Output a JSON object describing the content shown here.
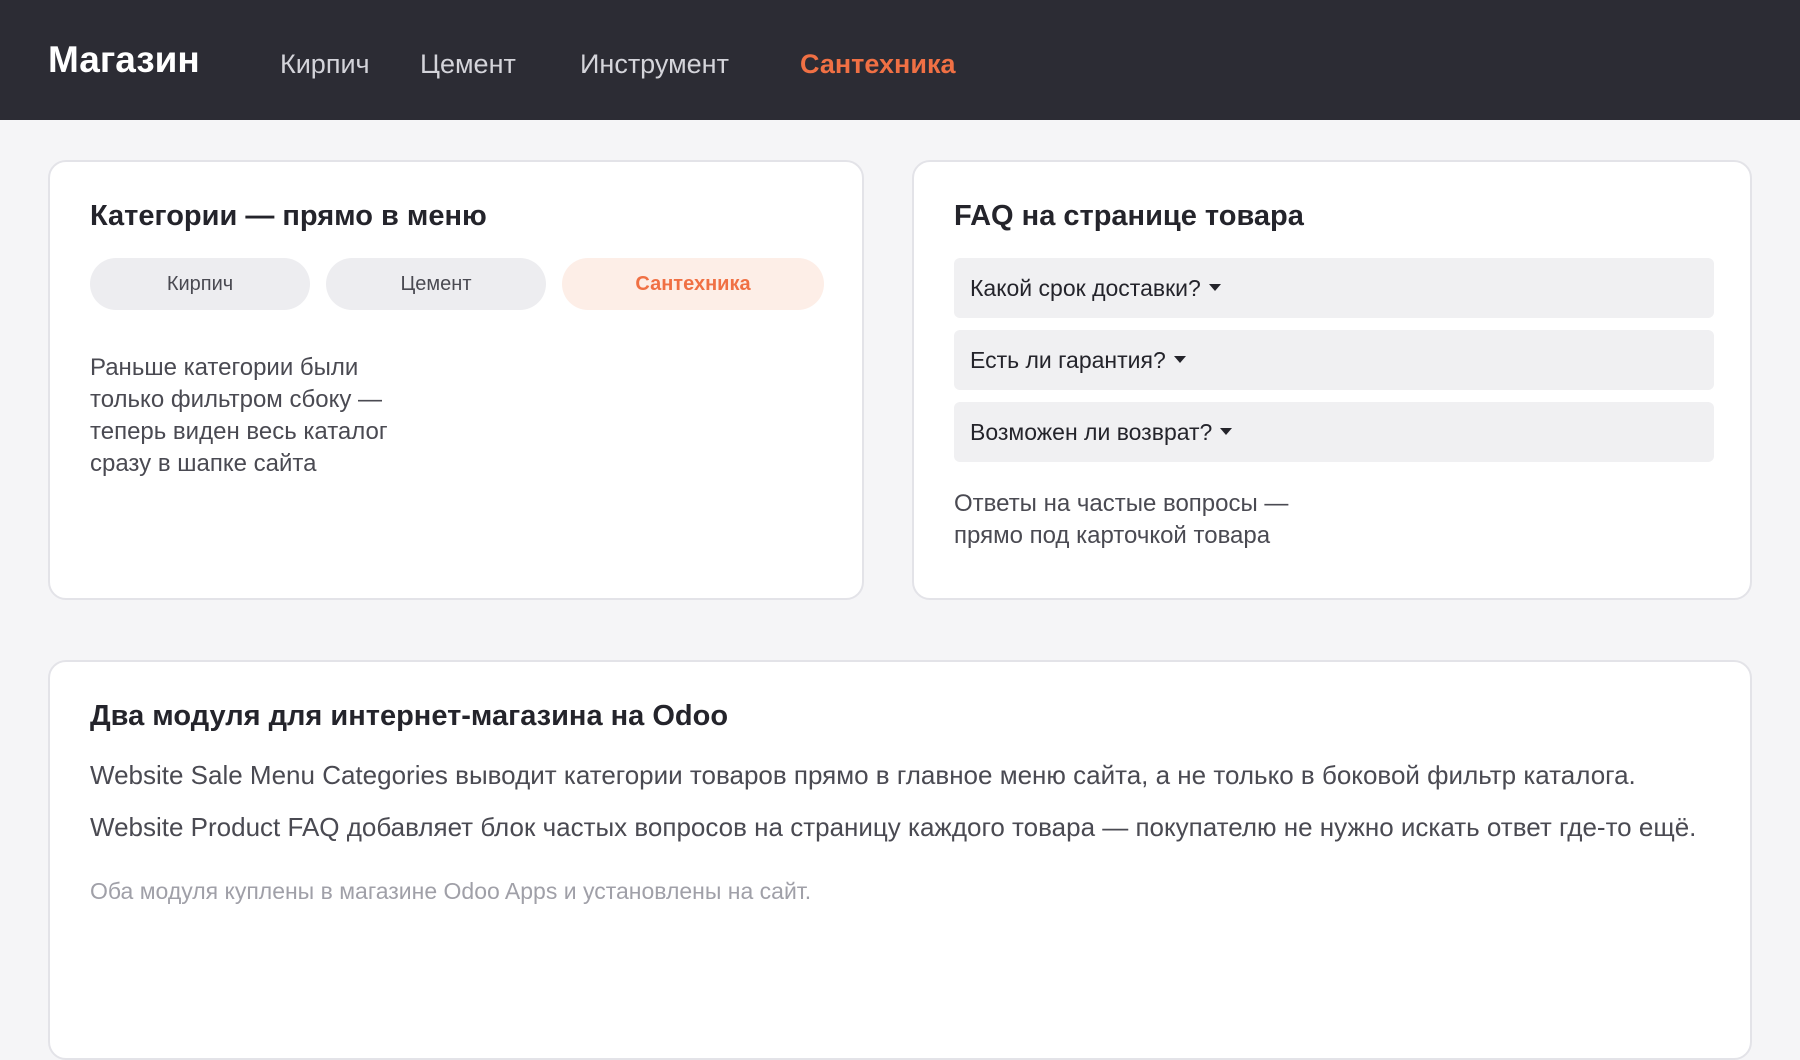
{
  "header": {
    "brand": "Магазин",
    "nav": [
      {
        "label": "Кирпич",
        "active": false
      },
      {
        "label": "Цемент",
        "active": false
      },
      {
        "label": "Инструмент",
        "active": false
      },
      {
        "label": "Сантехника",
        "active": true
      }
    ]
  },
  "categories_card": {
    "title": "Категории — прямо в меню",
    "chips": [
      {
        "label": "Кирпич",
        "active": false
      },
      {
        "label": "Цемент",
        "active": false
      },
      {
        "label": "Сантехника",
        "active": true
      }
    ],
    "description_lines": [
      "Раньше категории были",
      "только фильтром сбоку —",
      "теперь виден весь каталог",
      "сразу в шапке сайта"
    ]
  },
  "faq_card": {
    "title": "FAQ на странице товара",
    "items": [
      {
        "question": "Какой срок доставки?"
      },
      {
        "question": "Есть ли гарантия?"
      },
      {
        "question": "Возможен ли возврат?"
      }
    ],
    "description_lines": [
      "Ответы на частые вопросы —",
      "прямо под карточкой товара"
    ]
  },
  "modules_card": {
    "title": "Два модуля для интернет-магазина на Odoo",
    "paragraphs": [
      "Website Sale Menu Categories выводит категории товаров прямо в главное меню сайта, а не только в боковой фильтр каталога.",
      "Website Product FAQ добавляет блок частых вопросов на страницу каждого товара — покупателю не нужно искать ответ где-то ещё."
    ],
    "note": "Оба модуля куплены в магазине Odoo Apps и установлены на сайт."
  },
  "colors": {
    "header_bg": "#2c2c34",
    "accent": "#f07044",
    "page_bg": "#f5f5f7"
  }
}
